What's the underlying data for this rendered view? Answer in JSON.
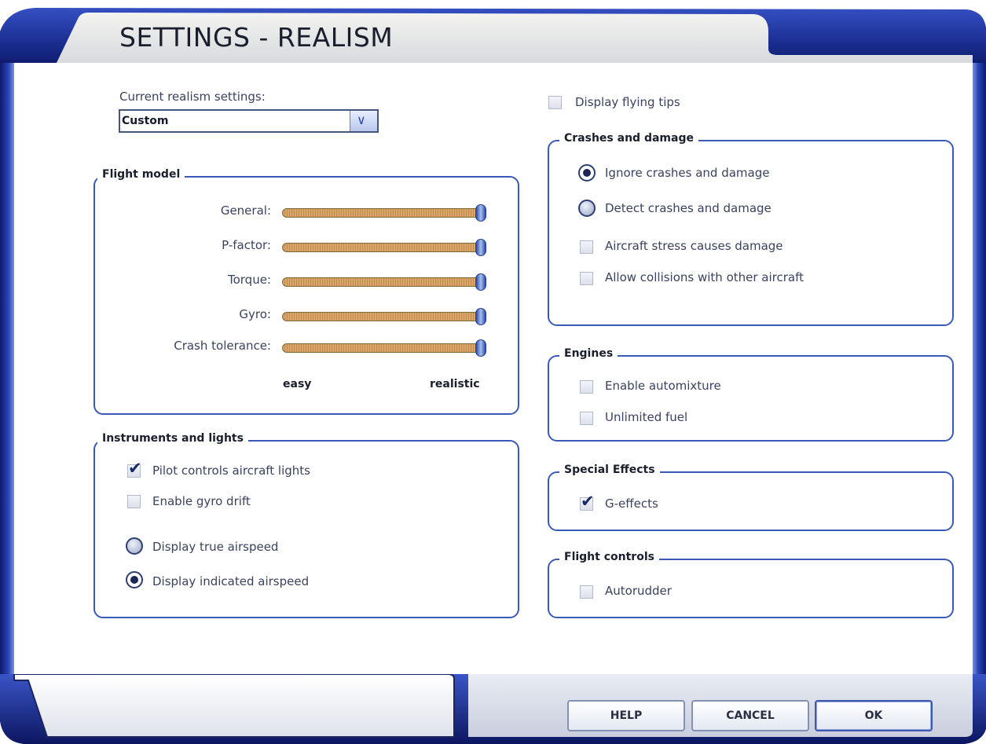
{
  "window": {
    "title": "SETTINGS - REALISM"
  },
  "realism_selector": {
    "label": "Current realism settings:",
    "value": "Custom"
  },
  "flight_model": {
    "title": "Flight model",
    "sliders": [
      {
        "label": "General:",
        "value": 1.0
      },
      {
        "label": "P-factor:",
        "value": 1.0
      },
      {
        "label": "Torque:",
        "value": 1.0
      },
      {
        "label": "Gyro:",
        "value": 1.0
      },
      {
        "label": "Crash tolerance:",
        "value": 1.0
      }
    ],
    "scale_min": "easy",
    "scale_max": "realistic"
  },
  "instruments": {
    "title": "Instruments and lights",
    "pilot_lights": {
      "label": "Pilot controls aircraft lights",
      "checked": true
    },
    "gyro_drift": {
      "label": "Enable gyro drift",
      "checked": false
    },
    "true_airspeed": {
      "label": "Display true airspeed",
      "selected": false
    },
    "indicated_airspeed": {
      "label": "Display indicated airspeed",
      "selected": true
    }
  },
  "flying_tips": {
    "label": "Display flying tips",
    "checked": false
  },
  "crashes": {
    "title": "Crashes and damage",
    "ignore": {
      "label": "Ignore crashes and damage",
      "selected": true
    },
    "detect": {
      "label": "Detect crashes and damage",
      "selected": false
    },
    "stress": {
      "label": "Aircraft stress causes damage",
      "checked": false
    },
    "collisions": {
      "label": "Allow collisions with other aircraft",
      "checked": false
    }
  },
  "engines": {
    "title": "Engines",
    "automixture": {
      "label": "Enable automixture",
      "checked": false
    },
    "unlimited_fuel": {
      "label": "Unlimited fuel",
      "checked": false
    }
  },
  "special_effects": {
    "title": "Special Effects",
    "g_effects": {
      "label": "G-effects",
      "checked": true
    }
  },
  "flight_controls": {
    "title": "Flight controls",
    "autorudder": {
      "label": "Autorudder",
      "checked": false
    }
  },
  "buttons": {
    "help": "HELP",
    "cancel": "CANCEL",
    "ok": "OK"
  },
  "colors": {
    "frame": "#1f3697",
    "accent": "#3a5aba",
    "slider_fill": "#d9a76b"
  }
}
